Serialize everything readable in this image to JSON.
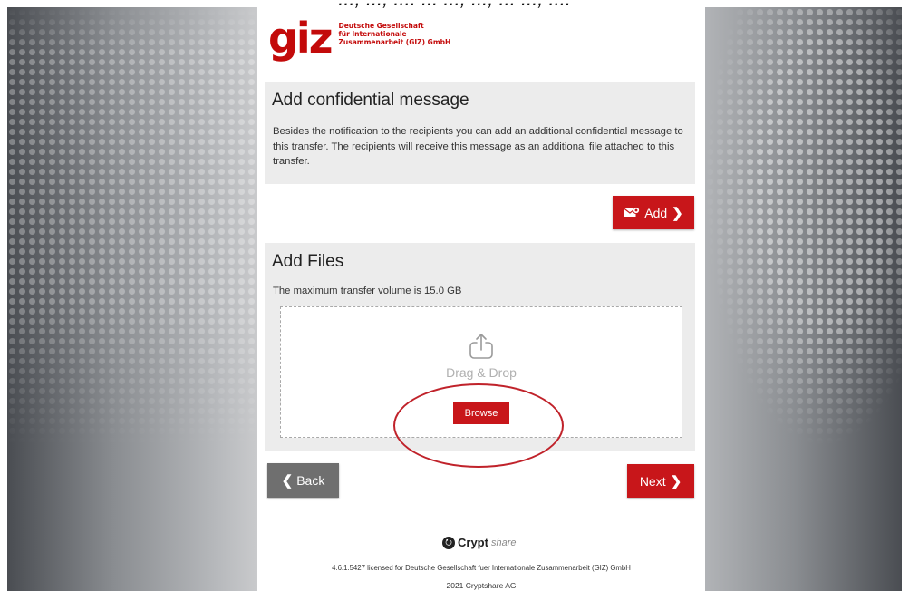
{
  "top_caption": "..., ..., .... ... ..., ..., ... ..., ....",
  "header": {
    "logo_mark": "giz",
    "logo_line1": "Deutsche Gesellschaft",
    "logo_line2": "für Internationale",
    "logo_line3": "Zusammenarbeit (GIZ) GmbH"
  },
  "confidential": {
    "title": "Add confidential message",
    "description": "Besides the notification to the recipients you can add an additional confidential message to this transfer. The recipients will receive this message as an additional file attached to this transfer.",
    "add_label": "Add",
    "add_icon": "envelope-icon"
  },
  "files": {
    "title": "Add Files",
    "max_volume": "The maximum transfer volume is 15.0 GB",
    "dropzone_text": "Drag & Drop",
    "upload_icon": "upload-icon",
    "browse_label": "Browse"
  },
  "nav": {
    "back_label": "Back",
    "next_label": "Next"
  },
  "footer": {
    "brand_bold": "Crypt",
    "brand_italic": "share",
    "license": "4.6.1.5427 licensed for Deutsche Gesellschaft fuer Internationale Zusammenarbeit (GIZ) GmbH",
    "copyright": "2021 Cryptshare AG"
  },
  "colors": {
    "accent_red": "#c8161a",
    "back_gray": "#6f6f6f",
    "section_bg": "#ececec",
    "highlight_ring": "#c0222a"
  }
}
